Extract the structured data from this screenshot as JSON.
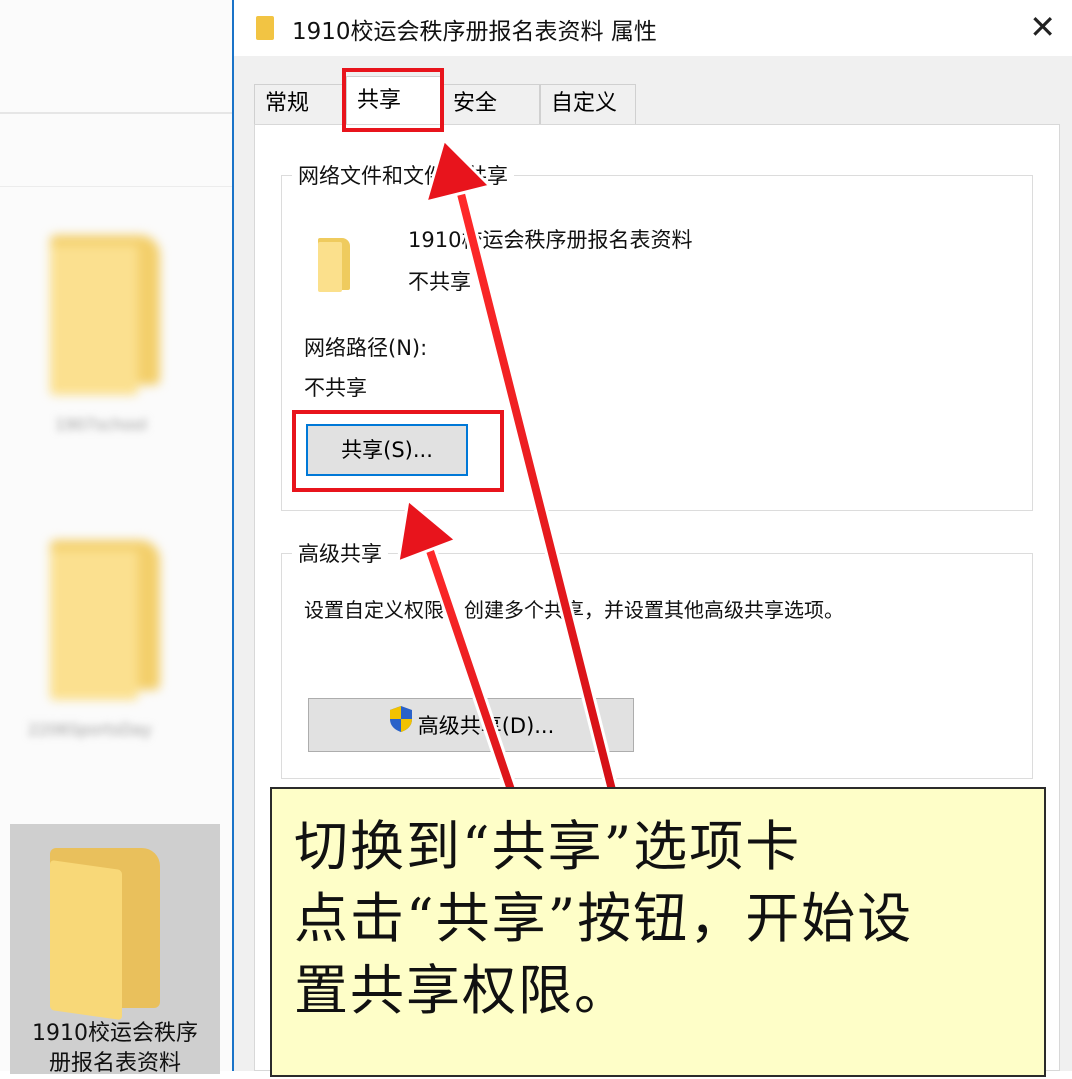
{
  "explorer": {
    "blurred_labels": [
      "1907school",
      "2206SportsDay"
    ],
    "selected_item_label": "1910校运会秩序\n册报名表资料"
  },
  "dialog": {
    "title": "1910校运会秩序册报名表资料 属性",
    "close_glyph": "✕",
    "tabs": [
      "常规",
      "共享",
      "安全",
      "自定义"
    ],
    "active_tab": "共享",
    "network_group": {
      "legend": "网络文件和文件夹共享",
      "item_name": "1910校运会秩序册报名表资料",
      "item_status": "不共享",
      "path_label": "网络路径(N):",
      "path_value": "不共享",
      "share_button": "共享(S)..."
    },
    "advanced_group": {
      "legend": "高级共享",
      "description": "设置自定义权限，创建多个共享，并设置其他高级共享选项。",
      "button": "高级共享(D)..."
    }
  },
  "annotation": {
    "callout_text": "切换到“共享”选项卡\n点击“共享”按钮，开始设\n置共享权限。",
    "highlight_color": "#e8141c",
    "callout_bg": "#fefec8"
  }
}
